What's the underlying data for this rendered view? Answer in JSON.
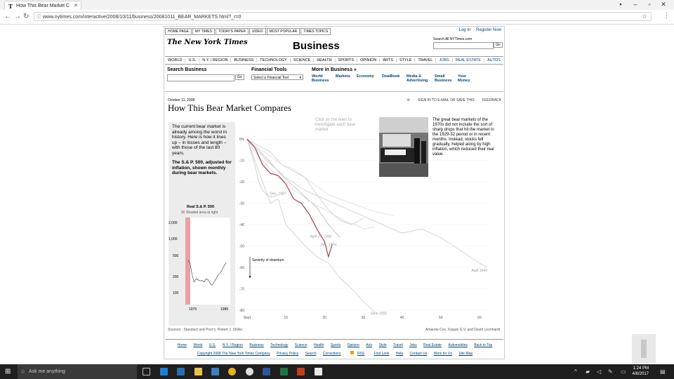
{
  "browser": {
    "tab_title": "How This Bear Market C",
    "url": "www.nytimes.com/interactive/2008/10/11/business/20081011_BEAR_MARKETS.html?_r=0"
  },
  "page": {
    "top_tabs": [
      "HOME PAGE",
      "MY TIMES",
      "TODAY'S PAPER",
      "VIDEO",
      "MOST POPULAR",
      "TIMES TOPICS"
    ],
    "login": "Log In",
    "register": "Register Now",
    "logo": "The New York Times",
    "section_title": "Business",
    "search_label": "Search All NYTimes.com",
    "go": "Go",
    "section_nav": [
      "WORLD",
      "U.S.",
      "N.Y. / REGION",
      "BUSINESS",
      "TECHNOLOGY",
      "SCIENCE",
      "HEALTH",
      "SPORTS",
      "OPINION",
      "ARTS",
      "STYLE",
      "TRAVEL",
      "JOBS",
      "REAL ESTATE",
      "AUTOS"
    ],
    "search_business": "Search Business",
    "financial_tools": "Financial Tools",
    "select_tool": "Select a Financial Tool",
    "more_in_business": "More in Business »",
    "more_links": [
      "World Business",
      "Markets",
      "Economy",
      "DealBook",
      "Media & Advertising",
      "Small Business",
      "Your Money"
    ]
  },
  "article": {
    "dateline": "October 11, 2008",
    "headline": "How This Bear Market Compares",
    "tools": [
      "SIGN IN TO E-MAIL OR SAVE THIS",
      "FEEDBACK"
    ],
    "intro_1": "The current bear market is already among the worst in history. Here is how it lines up – in losses and length – with those of the last 80 years.",
    "intro_2": "The S.& P. 500, adjusted for inflation, shown monthly during bear markets.",
    "hint": "Click on the lines to investigate each bear market",
    "photo_caption": "The great bear markets of the 1970s did not include the sort of sharp drops that hit the market in the 1929-32 period or in recent months. Instead, stocks fell gradually, helped along by high inflation, which reduced their real value.",
    "sources": "Sources : Standard and Poor's, Robert J. Shiller",
    "credits": "Amanda Cox, Xaquin G.V. and David Leonhardt"
  },
  "chart_data": [
    {
      "type": "line",
      "title": "",
      "xlabel": "Months",
      "ylabel": "Severity of downturn",
      "x_ticks": [
        "Start",
        "10",
        "20",
        "30",
        "40",
        "50",
        "60"
      ],
      "y_ticks": [
        "0%",
        "-10",
        "-20",
        "-30",
        "-40",
        "-50",
        "-60",
        "-70",
        "-80"
      ],
      "xlim": [
        0,
        62
      ],
      "ylim": [
        -82,
        5
      ],
      "annotations": [
        "Dec. 1987",
        "April 20, 2000",
        "Dec. 1974",
        "June 1932",
        "April 1942"
      ],
      "series": [
        {
          "x": [
            0,
            2,
            4,
            6,
            8,
            10,
            12,
            14,
            16,
            18,
            20,
            21,
            22
          ],
          "y": [
            0,
            -4,
            -12,
            -16,
            -17,
            -21,
            -28,
            -30,
            -35,
            -42,
            -48,
            -55,
            -49
          ],
          "color": "#a0444e"
        },
        {
          "x": [
            0,
            2,
            4,
            6,
            8,
            10,
            12,
            15,
            18,
            21,
            24,
            27,
            30,
            33
          ],
          "y": [
            0,
            -10,
            -20,
            -30,
            -28,
            -40,
            -44,
            -50,
            -55,
            -58,
            -65,
            -70,
            -76,
            -81
          ],
          "color": "#cccccc"
        },
        {
          "x": [
            0,
            3,
            6,
            9,
            12,
            15,
            18,
            21,
            24
          ],
          "y": [
            0,
            -5,
            -11,
            -17,
            -22,
            -27,
            -32,
            -40,
            -46
          ],
          "color": "#bbbbbb"
        },
        {
          "x": [
            0,
            3,
            6,
            9,
            12,
            15,
            18,
            21,
            24,
            27,
            30
          ],
          "y": [
            0,
            -3,
            -6,
            -12,
            -15,
            -18,
            -26,
            -33,
            -38,
            -40,
            -37
          ],
          "color": "#cccccc"
        },
        {
          "x": [
            0,
            2,
            4,
            6,
            8,
            10,
            12,
            14,
            16,
            18,
            20,
            22,
            24,
            26,
            28,
            30,
            33
          ],
          "y": [
            0,
            -6,
            -10,
            -14,
            -18,
            -20,
            -24,
            -26,
            -29,
            -31,
            -33,
            -35,
            -37,
            -39,
            -40,
            -42,
            -41
          ],
          "color": "#d6d6d6"
        },
        {
          "x": [
            0,
            5,
            10,
            15,
            20,
            25,
            30,
            35,
            40,
            45,
            50,
            55,
            60,
            62
          ],
          "y": [
            0,
            -10,
            -18,
            -24,
            -28,
            -32,
            -36,
            -40,
            -44,
            -42,
            -46,
            -52,
            -58,
            -60
          ],
          "color": "#cccccc"
        },
        {
          "x": [
            0,
            1,
            2,
            3,
            4,
            5,
            6,
            7,
            8
          ],
          "y": [
            0,
            -6,
            -12,
            -20,
            -24,
            -26,
            -27,
            -27,
            -26
          ],
          "color": "#c4c4c4"
        },
        {
          "x": [
            0,
            3,
            6,
            9,
            12,
            15,
            18,
            21,
            24,
            27,
            30,
            33,
            36,
            38
          ],
          "y": [
            0,
            -4,
            -8,
            -12,
            -14,
            -18,
            -22,
            -26,
            -28,
            -30,
            -32,
            -34,
            -35,
            -36
          ],
          "color": "#dddddd"
        }
      ]
    },
    {
      "type": "line",
      "title": "Real S.& P. 500",
      "legend": "Shaded area at right",
      "y_ticks": [
        "2,000",
        "1,000",
        "500",
        "200",
        "100"
      ],
      "x_ticks": [
        "1975",
        "1985"
      ],
      "series": [
        {
          "x": [
            0,
            1,
            2,
            3,
            4,
            5,
            6,
            7,
            8,
            9,
            10,
            11,
            12,
            13,
            14,
            15,
            16,
            17,
            18,
            19
          ],
          "y": [
            520,
            450,
            300,
            230,
            260,
            250,
            240,
            245,
            230,
            260,
            250,
            220,
            205,
            230,
            260,
            300,
            320,
            360,
            420,
            470
          ],
          "color": "#333333"
        }
      ]
    }
  ],
  "footer": {
    "links": [
      "Home",
      "World",
      "U.S.",
      "N.Y. / Region",
      "Business",
      "Technology",
      "Science",
      "Health",
      "Sports",
      "Opinion",
      "Arts",
      "Style",
      "Travel",
      "Jobs",
      "Real Estate",
      "Automobiles",
      "Back to Top"
    ],
    "links2": [
      "Copyright 2008 The New York Times Company",
      "Privacy Policy",
      "Search",
      "Corrections",
      "RSS",
      "First Look",
      "Help",
      "Contact Us",
      "Work for Us",
      "Site Map"
    ]
  },
  "taskbar": {
    "search_placeholder": "Ask me anything",
    "time": "1:24 PM",
    "date": "4/8/2017"
  }
}
